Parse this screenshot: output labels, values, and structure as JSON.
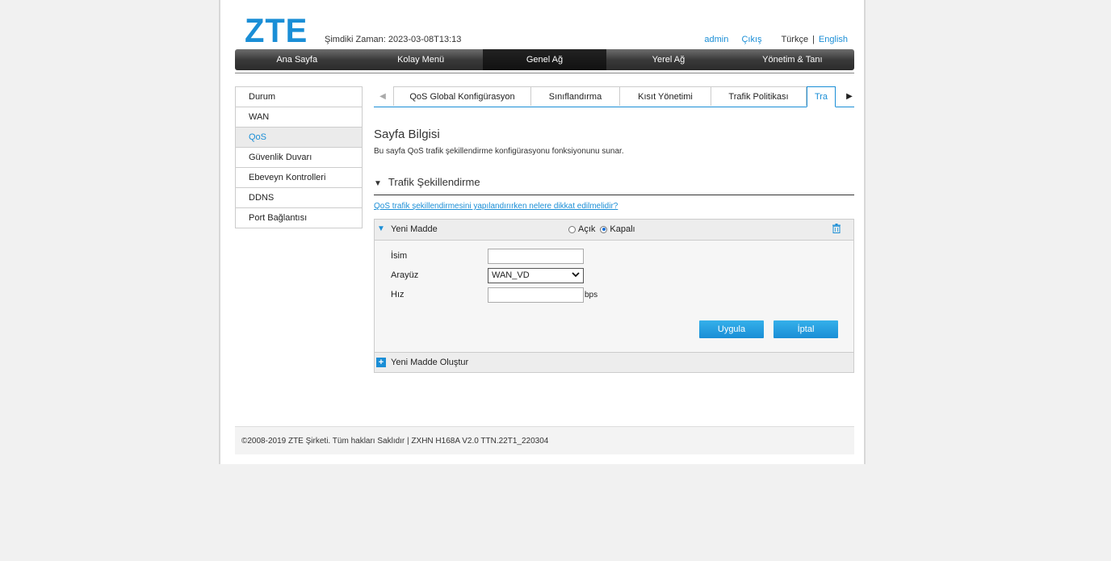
{
  "header": {
    "logo": "ZTE",
    "time_label": "Şimdiki Zaman: 2023-03-08T13:13",
    "admin": "admin",
    "logout": "Çıkış",
    "lang_tr": "Türkçe",
    "lang_sep": "|",
    "lang_en": "English"
  },
  "nav": [
    "Ana Sayfa",
    "Kolay Menü",
    "Genel Ağ",
    "Yerel Ağ",
    "Yönetim & Tanı"
  ],
  "sidebar": [
    "Durum",
    "WAN",
    "QoS",
    "Güvenlik Duvarı",
    "Ebeveyn Kontrolleri",
    "DDNS",
    "Port Bağlantısı"
  ],
  "tabs": [
    "QoS Global Konfigürasyon",
    "Sınıflandırma",
    "Kısıt Yönetimi",
    "Trafik Politikası",
    "Tra"
  ],
  "page": {
    "title": "Sayfa Bilgisi",
    "description": "Bu sayfa QoS trafik şekillendirme konfigürasyonu fonksiyonunu sunar.",
    "section": "Trafik Şekillendirme",
    "help_link": "QoS trafik şekillendirmesini yapılandırırken nelere dikkat edilmelidir?"
  },
  "panel": {
    "title": "Yeni Madde",
    "radio_on": "Açık",
    "radio_off": "Kapalı",
    "name_label": "İsim",
    "name_value": "",
    "iface_label": "Arayüz",
    "iface_value": "WAN_VD",
    "speed_label": "Hız",
    "speed_value": "",
    "speed_unit": "bps",
    "apply": "Uygula",
    "cancel": "İptal",
    "create": "Yeni Madde Oluştur"
  },
  "footer": "©2008-2019 ZTE Şirketi. Tüm hakları Saklıdır  |  ZXHN H168A V2.0 TTN.22T1_220304",
  "colors": {
    "accent": "#1a8ed6",
    "nav_dark": "#2b2b2b"
  }
}
